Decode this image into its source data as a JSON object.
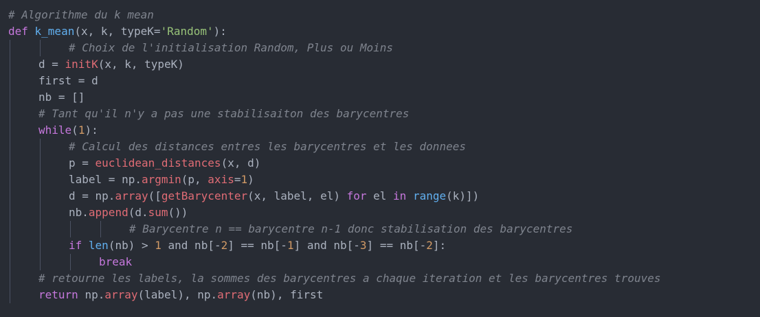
{
  "lines": [
    {
      "indent": 0,
      "tokens": [
        [
          "cm",
          "# Algorithme du k mean"
        ]
      ]
    },
    {
      "indent": 0,
      "tokens": [
        [
          "kw",
          "def "
        ],
        [
          "fn",
          "k_mean"
        ],
        [
          "plain",
          "(x, k, typeK="
        ],
        [
          "str",
          "'Random'"
        ],
        [
          "plain",
          "):"
        ]
      ]
    },
    {
      "indent": 2,
      "tokens": [
        [
          "cm",
          "# Choix de l'initialisation Random, Plus ou Moins"
        ]
      ]
    },
    {
      "indent": 1,
      "tokens": [
        [
          "plain",
          "d = "
        ],
        [
          "fncall",
          "initK"
        ],
        [
          "plain",
          "(x, k, typeK)"
        ]
      ]
    },
    {
      "indent": 1,
      "tokens": [
        [
          "plain",
          "first = d"
        ]
      ]
    },
    {
      "indent": 1,
      "tokens": [
        [
          "plain",
          "nb = []"
        ]
      ]
    },
    {
      "indent": 1,
      "tokens": [
        [
          "cm",
          "# Tant qu'il n'y a pas une stabilisaiton des barycentres"
        ]
      ]
    },
    {
      "indent": 1,
      "tokens": [
        [
          "kw",
          "while"
        ],
        [
          "plain",
          "("
        ],
        [
          "num",
          "1"
        ],
        [
          "plain",
          "):"
        ]
      ]
    },
    {
      "indent": 2,
      "tokens": [
        [
          "cm",
          "# Calcul des distances entres les barycentres et les donnees"
        ]
      ]
    },
    {
      "indent": 2,
      "tokens": [
        [
          "plain",
          "p = "
        ],
        [
          "fncall",
          "euclidean_distances"
        ],
        [
          "plain",
          "(x, d)"
        ]
      ]
    },
    {
      "indent": 2,
      "tokens": [
        [
          "plain",
          "label = np."
        ],
        [
          "fncall",
          "argmin"
        ],
        [
          "plain",
          "(p, "
        ],
        [
          "var",
          "axis"
        ],
        [
          "plain",
          "="
        ],
        [
          "num",
          "1"
        ],
        [
          "plain",
          ")"
        ]
      ]
    },
    {
      "indent": 2,
      "tokens": [
        [
          "plain",
          "d = np."
        ],
        [
          "fncall",
          "array"
        ],
        [
          "plain",
          "(["
        ],
        [
          "fncall",
          "getBarycenter"
        ],
        [
          "plain",
          "(x, label, el) "
        ],
        [
          "kw",
          "for"
        ],
        [
          "plain",
          " el "
        ],
        [
          "kw",
          "in"
        ],
        [
          "plain",
          " "
        ],
        [
          "bi",
          "range"
        ],
        [
          "plain",
          "(k)])"
        ]
      ]
    },
    {
      "indent": 2,
      "tokens": [
        [
          "plain",
          "nb."
        ],
        [
          "fncall",
          "append"
        ],
        [
          "plain",
          "(d."
        ],
        [
          "fncall",
          "sum"
        ],
        [
          "plain",
          "())"
        ]
      ]
    },
    {
      "indent": 4,
      "tokens": [
        [
          "cm",
          "# Barycentre n == barycentre n-1 donc stabilisation des barycentres"
        ]
      ]
    },
    {
      "indent": 2,
      "tokens": [
        [
          "kw",
          "if "
        ],
        [
          "bi",
          "len"
        ],
        [
          "plain",
          "(nb) > "
        ],
        [
          "num",
          "1"
        ],
        [
          "plain",
          " and nb[-"
        ],
        [
          "num",
          "2"
        ],
        [
          "plain",
          "] == nb[-"
        ],
        [
          "num",
          "1"
        ],
        [
          "plain",
          "] and nb[-"
        ],
        [
          "num",
          "3"
        ],
        [
          "plain",
          "] == nb[-"
        ],
        [
          "num",
          "2"
        ],
        [
          "plain",
          "]:"
        ]
      ]
    },
    {
      "indent": 3,
      "tokens": [
        [
          "kw",
          "break"
        ]
      ]
    },
    {
      "indent": 1,
      "tokens": [
        [
          "cm",
          "# retourne les labels, la sommes des barycentres a chaque iteration et les barycentres trouves"
        ]
      ]
    },
    {
      "indent": 1,
      "tokens": [
        [
          "kw",
          "return "
        ],
        [
          "plain",
          "np."
        ],
        [
          "fncall",
          "array"
        ],
        [
          "plain",
          "(label), np."
        ],
        [
          "fncall",
          "array"
        ],
        [
          "plain",
          "(nb), first"
        ]
      ]
    }
  ],
  "colors": {
    "background": "#282c34",
    "keyword": "#c678dd",
    "function": "#61afef",
    "string": "#98c379",
    "number": "#d19a66",
    "call": "#e06c75",
    "comment": "#7f848e",
    "plain": "#abb2bf"
  }
}
